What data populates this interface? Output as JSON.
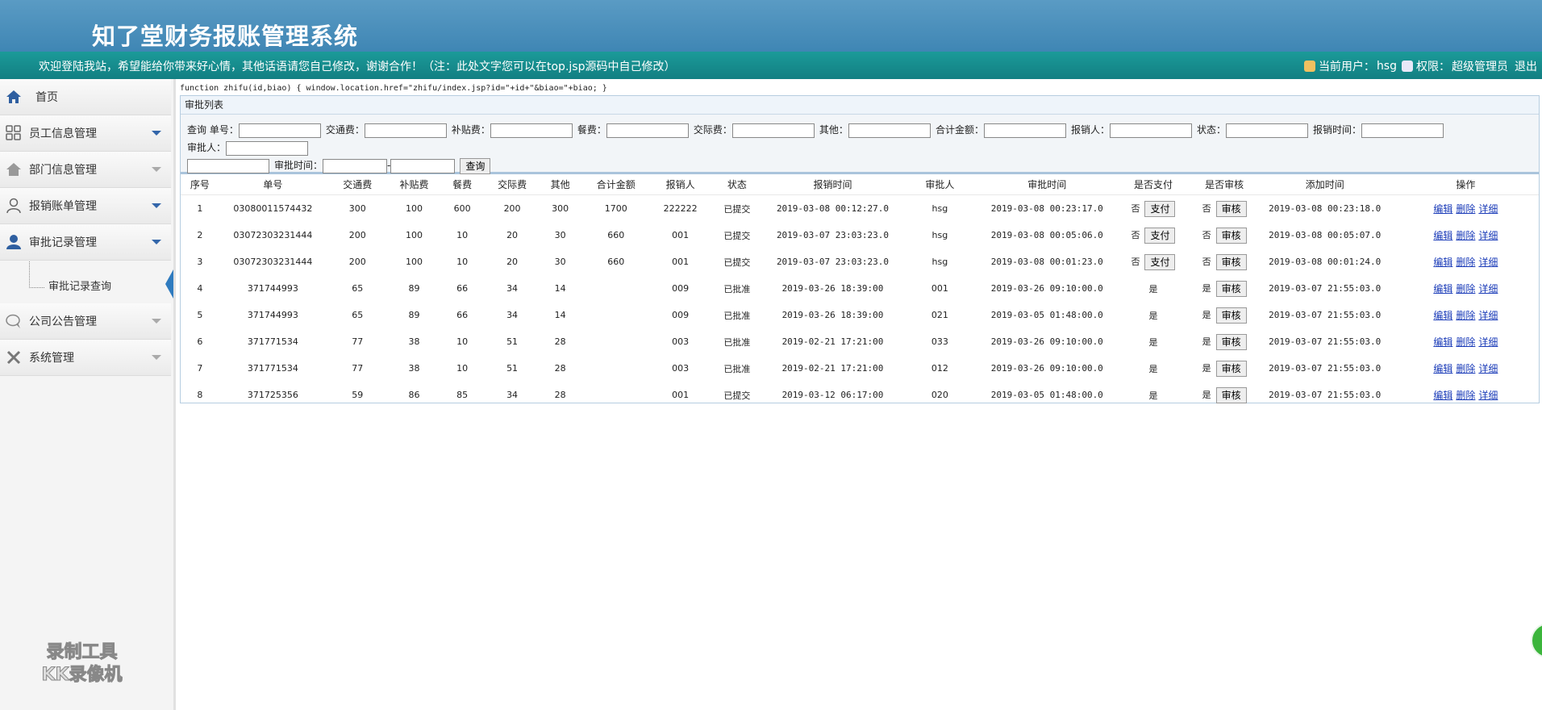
{
  "header": {
    "title": "知了堂财务报账管理系统",
    "welcome": "欢迎登陆我站，希望能给你带来好心情，其他话语请您自己修改，谢谢合作！（注：此处文字您可以在top.jsp源码中自己修改）",
    "current_user_label": "当前用户：",
    "current_user": "hsg",
    "permission_label": "权限：",
    "permission": "超级管理员",
    "logout": "退出"
  },
  "sidebar": {
    "items": [
      {
        "label": "首页",
        "icon": "home-icon"
      },
      {
        "label": "员工信息管理",
        "icon": "grid-icon"
      },
      {
        "label": "部门信息管理",
        "icon": "house-icon"
      },
      {
        "label": "报销账单管理",
        "icon": "user-outline-icon"
      },
      {
        "label": "审批记录管理",
        "icon": "user-solid-icon"
      },
      {
        "label": "公司公告管理",
        "icon": "chat-icon"
      },
      {
        "label": "系统管理",
        "icon": "tools-icon"
      }
    ],
    "sub_items": [
      {
        "label": "审批记录查询"
      }
    ],
    "watermark_line1": "录制工具",
    "watermark_line2": "KK录像机"
  },
  "main": {
    "function_text": "function zhifu(id,biao) { window.location.href=\"zhifu/index.jsp?id=\"+id+\"&biao=\"+biao; }",
    "panel_title": "审批列表",
    "search": {
      "query_label": "查询",
      "fields": [
        "单号：",
        "交通费：",
        "补贴费：",
        "餐费：",
        "交际费：",
        "其他：",
        "合计金额：",
        "报销人：",
        "状态：",
        "报销时间：",
        "审批人："
      ],
      "approve_time_label": "审批时间：",
      "range_sep": "-",
      "button": "查询"
    },
    "table": {
      "columns": [
        "序号",
        "单号",
        "交通费",
        "补贴费",
        "餐费",
        "交际费",
        "其他",
        "合计金额",
        "报销人",
        "状态",
        "报销时间",
        "审批人",
        "审批时间",
        "是否支付",
        "是否审核",
        "添加时间",
        "操作"
      ],
      "pay_button": "支付",
      "review_button": "审核",
      "actions": [
        "编辑",
        "删除",
        "详细"
      ],
      "rows": [
        {
          "no": "1",
          "order": "03080011574432",
          "traffic": "300",
          "subsidy": "100",
          "meal": "600",
          "social": "200",
          "other": "300",
          "total": "1700",
          "person": "222222",
          "status": "已提交",
          "submit_time": "2019-03-08 00:12:27.0",
          "approver": "hsg",
          "approve_time": "2019-03-08 00:23:17.0",
          "paid": "否",
          "reviewed": "否",
          "add_time": "2019-03-08 00:23:18.0",
          "show_pay": true
        },
        {
          "no": "2",
          "order": "03072303231444",
          "traffic": "200",
          "subsidy": "100",
          "meal": "10",
          "social": "20",
          "other": "30",
          "total": "660",
          "person": "001",
          "status": "已提交",
          "submit_time": "2019-03-07 23:03:23.0",
          "approver": "hsg",
          "approve_time": "2019-03-08 00:05:06.0",
          "paid": "否",
          "reviewed": "否",
          "add_time": "2019-03-08 00:05:07.0",
          "show_pay": true
        },
        {
          "no": "3",
          "order": "03072303231444",
          "traffic": "200",
          "subsidy": "100",
          "meal": "10",
          "social": "20",
          "other": "30",
          "total": "660",
          "person": "001",
          "status": "已提交",
          "submit_time": "2019-03-07 23:03:23.0",
          "approver": "hsg",
          "approve_time": "2019-03-08 00:01:23.0",
          "paid": "否",
          "reviewed": "否",
          "add_time": "2019-03-08 00:01:24.0",
          "show_pay": true
        },
        {
          "no": "4",
          "order": "371744993",
          "traffic": "65",
          "subsidy": "89",
          "meal": "66",
          "social": "34",
          "other": "14",
          "total": "",
          "person": "009",
          "status": "已批准",
          "submit_time": "2019-03-26 18:39:00",
          "approver": "001",
          "approve_time": "2019-03-26 09:10:00.0",
          "paid": "是",
          "reviewed": "是",
          "add_time": "2019-03-07 21:55:03.0",
          "show_pay": false
        },
        {
          "no": "5",
          "order": "371744993",
          "traffic": "65",
          "subsidy": "89",
          "meal": "66",
          "social": "34",
          "other": "14",
          "total": "",
          "person": "009",
          "status": "已批准",
          "submit_time": "2019-03-26 18:39:00",
          "approver": "021",
          "approve_time": "2019-03-05 01:48:00.0",
          "paid": "是",
          "reviewed": "是",
          "add_time": "2019-03-07 21:55:03.0",
          "show_pay": false
        },
        {
          "no": "6",
          "order": "371771534",
          "traffic": "77",
          "subsidy": "38",
          "meal": "10",
          "social": "51",
          "other": "28",
          "total": "",
          "person": "003",
          "status": "已批准",
          "submit_time": "2019-02-21 17:21:00",
          "approver": "033",
          "approve_time": "2019-03-26 09:10:00.0",
          "paid": "是",
          "reviewed": "是",
          "add_time": "2019-03-07 21:55:03.0",
          "show_pay": false
        },
        {
          "no": "7",
          "order": "371771534",
          "traffic": "77",
          "subsidy": "38",
          "meal": "10",
          "social": "51",
          "other": "28",
          "total": "",
          "person": "003",
          "status": "已批准",
          "submit_time": "2019-02-21 17:21:00",
          "approver": "012",
          "approve_time": "2019-03-26 09:10:00.0",
          "paid": "是",
          "reviewed": "是",
          "add_time": "2019-03-07 21:55:03.0",
          "show_pay": false
        },
        {
          "no": "8",
          "order": "371725356",
          "traffic": "59",
          "subsidy": "86",
          "meal": "85",
          "social": "34",
          "other": "28",
          "total": "",
          "person": "001",
          "status": "已提交",
          "submit_time": "2019-03-12 06:17:00",
          "approver": "020",
          "approve_time": "2019-03-05 01:48:00.0",
          "paid": "是",
          "reviewed": "是",
          "add_time": "2019-03-07 21:55:03.0",
          "show_pay": false
        }
      ]
    }
  },
  "colors": {
    "header": "#4a90be",
    "infobar": "#17908f",
    "link": "#1a3bb8"
  }
}
